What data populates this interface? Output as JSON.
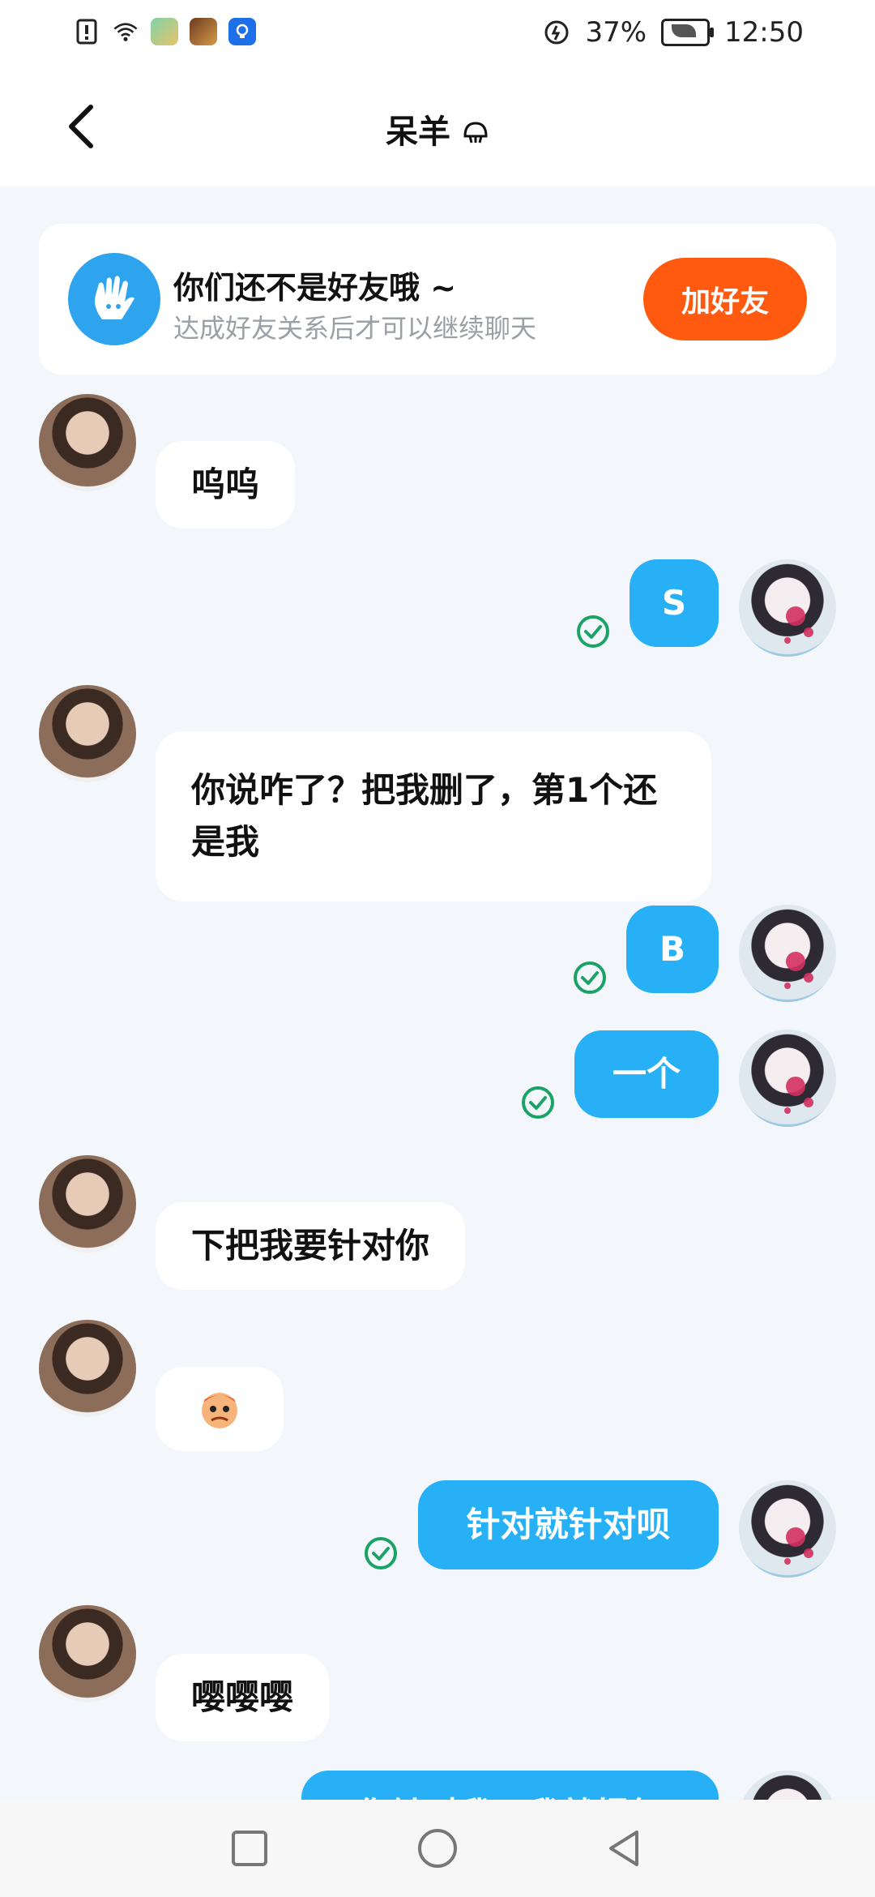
{
  "status_bar": {
    "battery": "37%",
    "time": "12:50"
  },
  "header": {
    "title": "呆羊",
    "title_icon": "shell-icon"
  },
  "banner": {
    "title": "你们还不是好友哦 ~",
    "subtitle": "达成好友关系后才可以继续聊天",
    "add_button": "加好友",
    "icon": "waving-hand-icon",
    "button_color": "#FF5A0F"
  },
  "messages": [
    {
      "side": "in",
      "text": "呜呜"
    },
    {
      "side": "out",
      "text": "S"
    },
    {
      "side": "in",
      "text": "你说咋了？把我删了，第1个还是我"
    },
    {
      "side": "out",
      "text": "B"
    },
    {
      "side": "out",
      "text": "一个"
    },
    {
      "side": "in",
      "text": "下把我要针对你"
    },
    {
      "side": "in",
      "text": "",
      "sticker": "monkey-sticker-icon"
    },
    {
      "side": "out",
      "text": "针对就针对呗"
    },
    {
      "side": "in",
      "text": "嘤嘤嘤"
    },
    {
      "side": "out",
      "text": "你针对我，我就报复"
    }
  ],
  "colors": {
    "outgoing_bubble": "#27B0F5",
    "incoming_bubble": "#FFFFFF",
    "read_check": "#1AA366",
    "background": "#F3F6FA"
  },
  "nav_bar": {
    "icons": [
      "recent-apps-icon",
      "home-icon",
      "back-icon"
    ]
  }
}
